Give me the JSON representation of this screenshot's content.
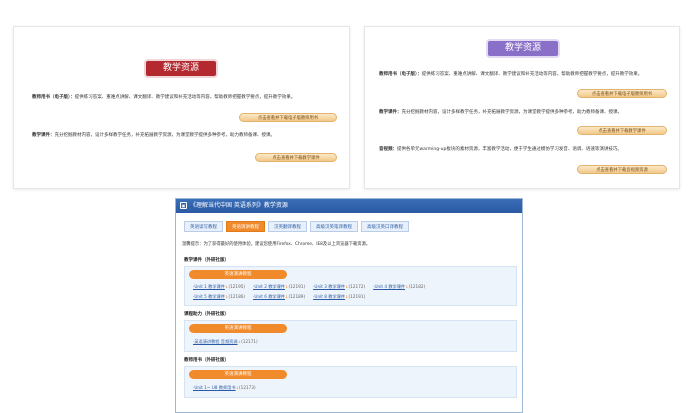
{
  "panel_left": {
    "title": "教学资源",
    "item1_label": "教师用书（电子版）：",
    "item1_text": "提供练习答案、重难点讲解、课文翻译、教学建议和补充活动等内容，帮助教师把握教学要点，提升教学效果。",
    "item1_button": "点击查看并下载电子版教师用书",
    "item2_label": "教学课件：",
    "item2_text": "充分挖掘教材内容，设计多样教学任务，补充拓展教学资源，为课堂教学提供多种参考，助力教师备课、授课。",
    "item2_button": "点击查看并下载教学课件"
  },
  "panel_right": {
    "title": "教学资源",
    "item1_label": "教师用书（电子版）：",
    "item1_text": "提供练习答案、重难点讲解、课文翻译、教学建议和补充活动等内容，帮助教师把握教学要点，提升教学效果。",
    "item1_button": "点击查看并下载电子版教师用书",
    "item2_label": "教学课件：",
    "item2_text": "充分挖掘教材内容，设计多样教学任务，补充拓展教学资源，为课堂教学提供多种参考，助力教师备课、授课。",
    "item2_button": "点击查看并下载教学课件",
    "item3_label": "音视频：",
    "item3_text": "提供各单元warming-up板块的素材资源，丰富教学活动，便于学生通过模仿学习发音、语调、语速等演讲技巧。",
    "item3_button": "点击查看并下载音视频资源"
  },
  "window": {
    "title": "《理解当代中国 英语系列》教学资源",
    "tabs": [
      "英语读写教程",
      "英语演讲教程",
      "汉英翻译教程",
      "高级汉英笔译教程",
      "高级汉英口译教程"
    ],
    "hint": "温馨提示：为了获得最好的使用体验，建议您使用Firefox、Chrome、IE8及以上浏览器下载资源。",
    "section1": {
      "label": "教学课件（外研社版）",
      "pill": "英语演讲教程",
      "row1": [
        {
          "text": "·Unit 1 教学课件",
          "count": "(12195)"
        },
        {
          "text": "·Unit 2 教学课件",
          "count": "(12191)"
        },
        {
          "text": "·Unit 3 教学课件",
          "count": "(12172)"
        },
        {
          "text": "·Unit 4 教学课件",
          "count": "(12182)"
        }
      ],
      "row2": [
        {
          "text": "·Unit 5 教学课件",
          "count": "(12186)"
        },
        {
          "text": "·Unit 6 教学课件",
          "count": "(12189)"
        },
        {
          "text": "·Unit 8 教学课件",
          "count": "(12191)"
        }
      ]
    },
    "section2": {
      "label": "课程助力（外研社版）",
      "pill": "英语演讲教程",
      "row1": [
        {
          "text": "·英语演讲教程 音频资源",
          "count": "(12171)"
        }
      ]
    },
    "section3": {
      "label": "教师用书（外研社版）",
      "pill": "英语演讲教程",
      "row1": [
        {
          "text": "·Unit 1~ U8 教师用书",
          "count": "(12173)"
        }
      ]
    }
  }
}
